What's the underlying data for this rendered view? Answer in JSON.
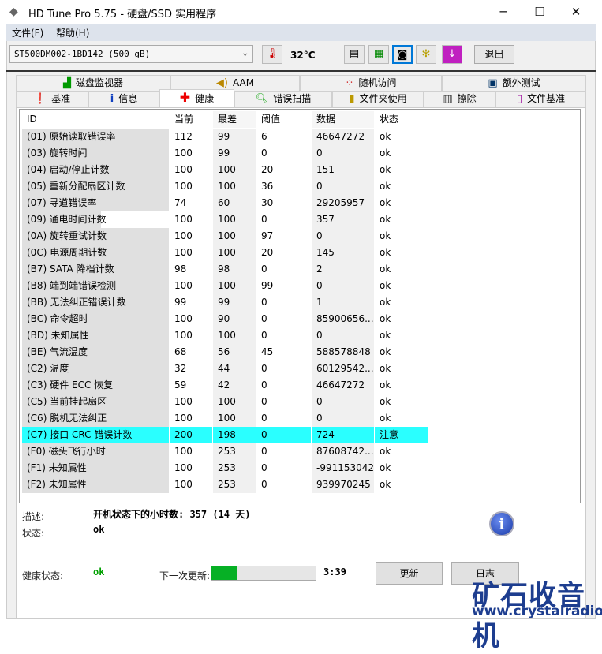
{
  "window": {
    "title": "HD Tune Pro 5.75 - 硬盘/SSD 实用程序",
    "minimize": "─",
    "maximize": "☐",
    "close": "✕"
  },
  "menu": [
    "文件(F)",
    "帮助(H)"
  ],
  "toolbar": {
    "drive": "ST500DM002-1BD142 (500 gB)",
    "temperature": "32°C",
    "exit": "退出"
  },
  "tabs_top": [
    {
      "label": "磁盘监视器",
      "icon": "monitor-chart-icon"
    },
    {
      "label": "AAM",
      "icon": "speaker-icon"
    },
    {
      "label": "随机访问",
      "icon": "scatter-icon"
    },
    {
      "label": "额外测试",
      "icon": "extra-test-icon"
    }
  ],
  "tabs_bottom": [
    {
      "label": "基准",
      "icon": "exclamation-icon"
    },
    {
      "label": "信息",
      "icon": "info-icon"
    },
    {
      "label": "健康",
      "icon": "red-cross-icon"
    },
    {
      "label": "错误扫描",
      "icon": "magnifier-icon"
    },
    {
      "label": "文件夹使用",
      "icon": "folder-icon"
    },
    {
      "label": "擦除",
      "icon": "trash-icon"
    },
    {
      "label": "文件基准",
      "icon": "file-benchmark-icon"
    }
  ],
  "table": {
    "headers": [
      "ID",
      "当前",
      "最差",
      "阈值",
      "数据",
      "状态"
    ],
    "rows": [
      [
        "(01) 原始读取错误率",
        "112",
        "99",
        "6",
        "46647272",
        "ok"
      ],
      [
        "(03) 旋转时间",
        "100",
        "99",
        "0",
        "0",
        "ok"
      ],
      [
        "(04) 启动/停止计数",
        "100",
        "100",
        "20",
        "151",
        "ok"
      ],
      [
        "(05) 重新分配扇区计数",
        "100",
        "100",
        "36",
        "0",
        "ok"
      ],
      [
        "(07) 寻道错误率",
        "74",
        "60",
        "30",
        "29205957",
        "ok"
      ],
      [
        "(09) 通电时间计数",
        "100",
        "100",
        "0",
        "357",
        "ok"
      ],
      [
        "(0A) 旋转重试计数",
        "100",
        "100",
        "97",
        "0",
        "ok"
      ],
      [
        "(0C) 电源周期计数",
        "100",
        "100",
        "20",
        "145",
        "ok"
      ],
      [
        "(B7) SATA 降档计数",
        "98",
        "98",
        "0",
        "2",
        "ok"
      ],
      [
        "(B8) 端到端错误检测",
        "100",
        "100",
        "99",
        "0",
        "ok"
      ],
      [
        "(BB) 无法纠正错误计数",
        "99",
        "99",
        "0",
        "1",
        "ok"
      ],
      [
        "(BC) 命令超时",
        "100",
        "90",
        "0",
        "85900656...",
        "ok"
      ],
      [
        "(BD) 未知属性",
        "100",
        "100",
        "0",
        "0",
        "ok"
      ],
      [
        "(BE) 气流温度",
        "68",
        "56",
        "45",
        "588578848",
        "ok"
      ],
      [
        "(C2) 温度",
        "32",
        "44",
        "0",
        "60129542...",
        "ok"
      ],
      [
        "(C3) 硬件 ECC 恢复",
        "59",
        "42",
        "0",
        "46647272",
        "ok"
      ],
      [
        "(C5) 当前挂起扇区",
        "100",
        "100",
        "0",
        "0",
        "ok"
      ],
      [
        "(C6) 脱机无法纠正",
        "100",
        "100",
        "0",
        "0",
        "ok"
      ],
      [
        "(C7) 接口 CRC 错误计数",
        "200",
        "198",
        "0",
        "724",
        "注意"
      ],
      [
        "(F0) 磁头飞行小时",
        "100",
        "253",
        "0",
        "87608742...",
        "ok"
      ],
      [
        "(F1) 未知属性",
        "100",
        "253",
        "0",
        "-991153042",
        "ok"
      ],
      [
        "(F2) 未知属性",
        "100",
        "253",
        "0",
        "939970245",
        "ok"
      ]
    ]
  },
  "details": {
    "desc_label": "描述:",
    "desc_value": "开机状态下的小时数: 357 (14 天)",
    "status_label": "状态:",
    "status_value": "ok"
  },
  "footer": {
    "health_label": "健康状态:",
    "health_value": "ok",
    "next_update_label": "下一次更新:",
    "next_update_progress": 0.25,
    "countdown": "3:39",
    "refresh": "更新",
    "log": "日志"
  },
  "watermark": {
    "title": "矿石收音机",
    "url": "www.crystalradio.cn"
  },
  "colors": {
    "highlight": "#2affff",
    "progress": "#06b025",
    "health_ok": "#00a000"
  }
}
